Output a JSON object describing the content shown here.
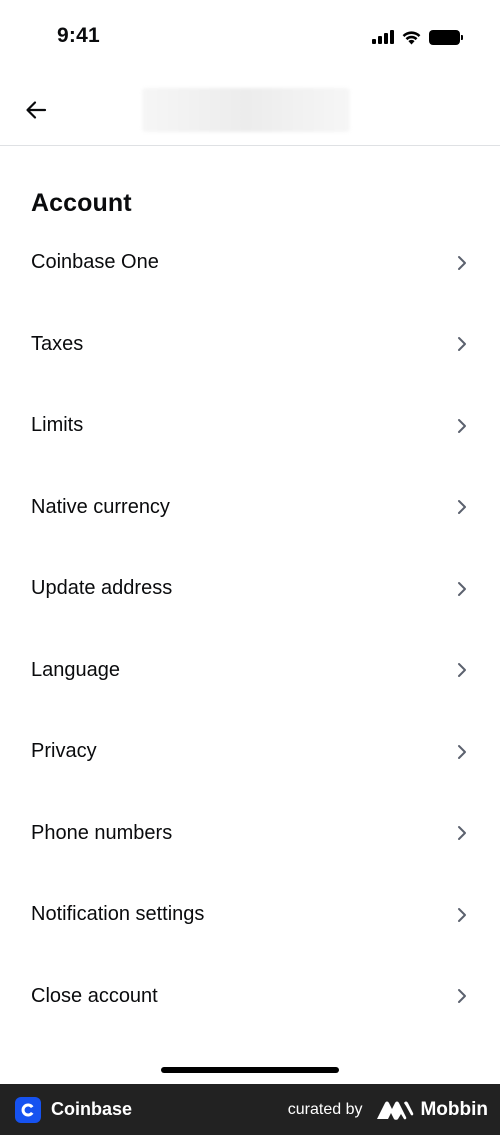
{
  "status_bar": {
    "time": "9:41"
  },
  "nav": {
    "back_icon": "arrow-left-icon",
    "title": ""
  },
  "section": {
    "title": "Account"
  },
  "menu": {
    "items": [
      {
        "label": "Coinbase One"
      },
      {
        "label": "Taxes"
      },
      {
        "label": "Limits"
      },
      {
        "label": "Native currency"
      },
      {
        "label": "Update address"
      },
      {
        "label": "Language"
      },
      {
        "label": "Privacy"
      },
      {
        "label": "Phone numbers"
      },
      {
        "label": "Notification settings"
      },
      {
        "label": "Close account"
      }
    ],
    "chevron_icon": "chevron-right-icon"
  },
  "footer": {
    "app_name": "Coinbase",
    "curated_by": "curated by",
    "brand": "Mobbin"
  },
  "colors": {
    "text": "#0a0b0d",
    "divider": "#dfe1e4",
    "chevron": "#5b616e",
    "coinbase_blue": "#1652f0",
    "footer_bg": "#222222"
  }
}
